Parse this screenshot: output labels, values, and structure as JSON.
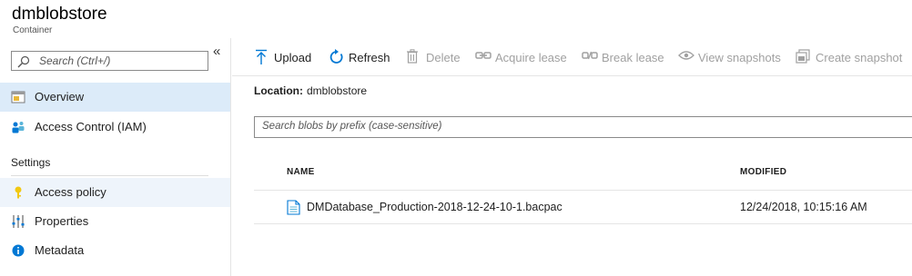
{
  "header": {
    "title": "dmblobstore",
    "subtitle": "Container"
  },
  "sidebar": {
    "search_placeholder": "Search (Ctrl+/)",
    "collapse_glyph": "«",
    "items": [
      {
        "label": "Overview",
        "icon": "overview-icon",
        "selected": true
      },
      {
        "label": "Access Control (IAM)",
        "icon": "iam-people-icon"
      }
    ],
    "section_label": "Settings",
    "settings_items": [
      {
        "label": "Access policy",
        "icon": "key-icon",
        "hover": true
      },
      {
        "label": "Properties",
        "icon": "sliders-icon"
      },
      {
        "label": "Metadata",
        "icon": "info-icon"
      }
    ]
  },
  "toolbar": {
    "upload": "Upload",
    "refresh": "Refresh",
    "delete": "Delete",
    "acquire_lease": "Acquire lease",
    "break_lease": "Break lease",
    "view_snapshots": "View snapshots",
    "create_snapshot": "Create snapshot"
  },
  "location": {
    "label": "Location:",
    "value": "dmblobstore"
  },
  "blob_search": {
    "placeholder": "Search blobs by prefix (case-sensitive)"
  },
  "table": {
    "columns": [
      "NAME",
      "MODIFIED"
    ],
    "rows": [
      {
        "name": "DMDatabase_Production-2018-12-24-10-1.bacpac",
        "modified": "12/24/2018, 10:15:16 AM"
      }
    ]
  },
  "colors": {
    "accent": "#0078d4",
    "selected_bg": "#dcebf9",
    "disabled_text": "#a0a0a0"
  }
}
